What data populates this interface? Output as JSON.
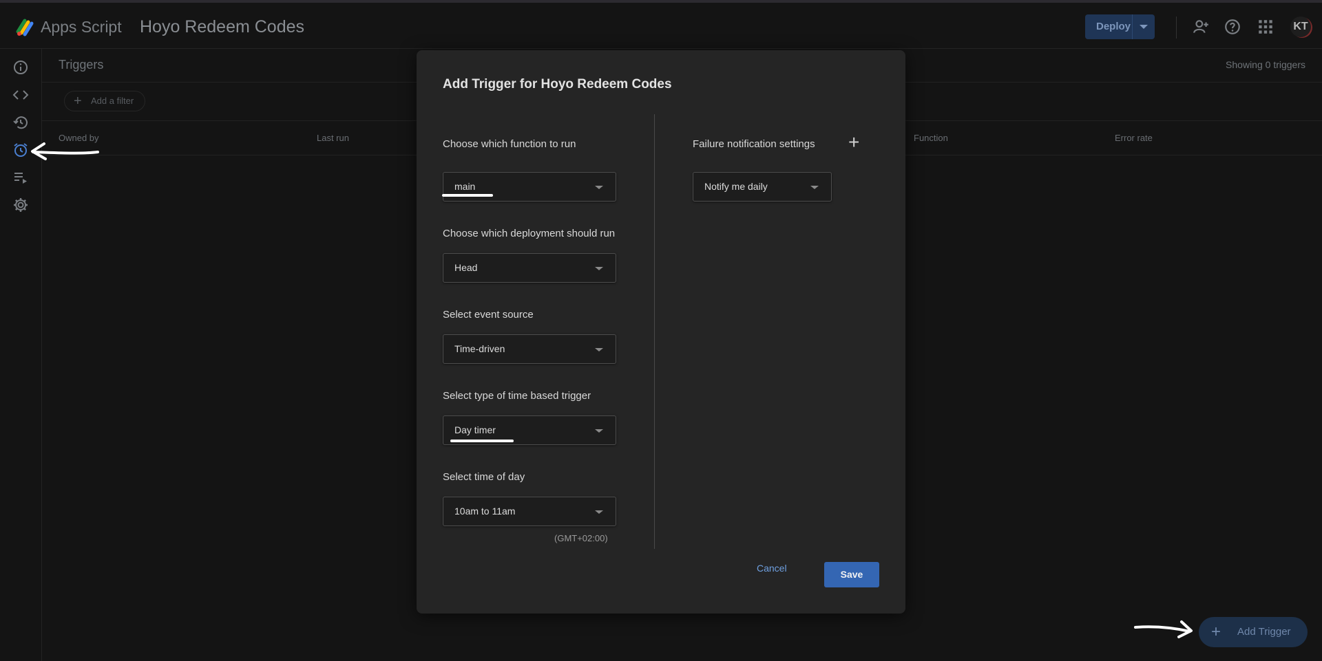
{
  "app": {
    "name": "Apps Script",
    "project": "Hoyo Redeem Codes"
  },
  "header": {
    "deploy_label": "Deploy",
    "avatar_initials": "KT"
  },
  "page": {
    "title": "Triggers",
    "showing": "Showing 0 triggers",
    "add_filter": "Add a filter",
    "columns": [
      "Owned by",
      "Last run",
      "Function",
      "Error rate"
    ],
    "fab_label": "Add Trigger"
  },
  "sidebar": {
    "items": [
      "overview-icon",
      "editor-icon",
      "history-icon",
      "triggers-icon",
      "executions-icon",
      "settings-icon"
    ]
  },
  "dialog": {
    "title": "Add Trigger for Hoyo Redeem Codes",
    "function_label": "Choose which function to run",
    "function_value": "main",
    "deployment_label": "Choose which deployment should run",
    "deployment_value": "Head",
    "event_source_label": "Select event source",
    "event_source_value": "Time-driven",
    "timer_type_label": "Select type of time based trigger",
    "timer_type_value": "Day timer",
    "time_of_day_label": "Select time of day",
    "time_of_day_value": "10am to 11am",
    "timezone": "(GMT+02:00)",
    "failure_label": "Failure notification settings",
    "failure_value": "Notify me daily",
    "cancel_label": "Cancel",
    "save_label": "Save"
  },
  "colors": {
    "accent": "#3466b3",
    "active_icon": "#4a7fd0",
    "background": "#141414",
    "dialog": "#252525"
  }
}
